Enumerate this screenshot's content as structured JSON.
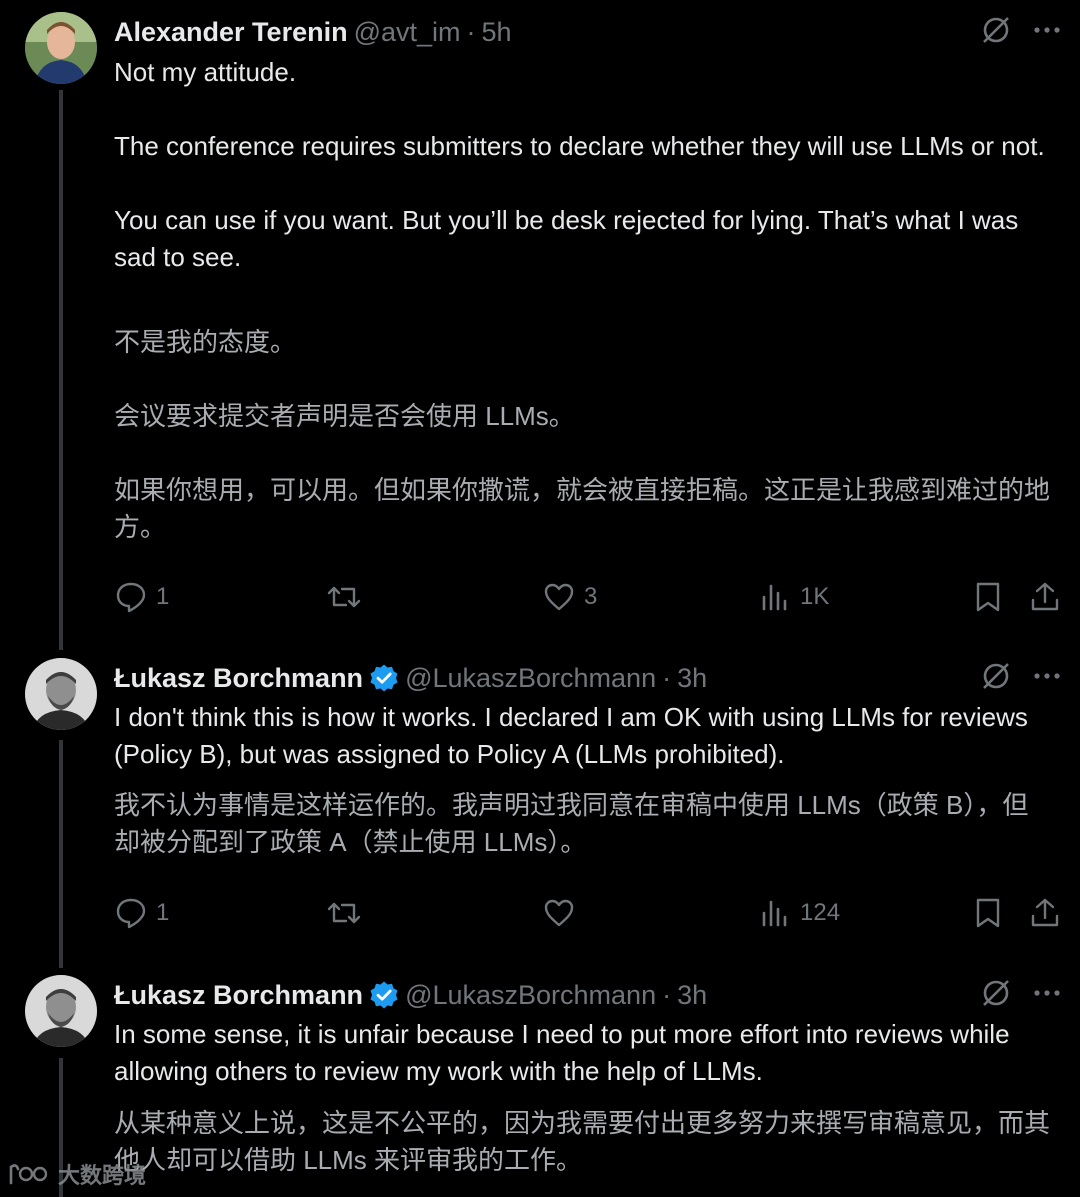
{
  "tweets": [
    {
      "author": "Alexander Terenin",
      "handle": "@avt_im",
      "separator": "·",
      "time": "5h",
      "verified": false,
      "text": [
        "Not my attitude.",
        "",
        "The conference requires submitters to declare whether they will use LLMs or not.",
        "",
        "You can use if you want. But you’ll be desk rejected for lying. That’s what I was sad to see."
      ],
      "translation": [
        "不是我的态度。",
        "",
        "会议要求提交者声明是否会使用 LLMs。",
        "",
        "如果你想用，可以用。但如果你撒谎，就会被直接拒稿。这正是让我感到难过的地方。"
      ],
      "actions": {
        "replies": "1",
        "reposts": "",
        "likes": "3",
        "views": "1K"
      }
    },
    {
      "author": "Łukasz Borchmann",
      "handle": "@LukaszBorchmann",
      "separator": "·",
      "time": "3h",
      "verified": true,
      "text": [
        "I don't think this is how it works. I declared I am OK with using LLMs for reviews (Policy B), but was assigned to Policy A (LLMs prohibited)."
      ],
      "translation": [
        "我不认为事情是这样运作的。我声明过我同意在审稿中使用 LLMs（政策 B），但却被分配到了政策 A（禁止使用 LLMs）。"
      ],
      "actions": {
        "replies": "1",
        "reposts": "",
        "likes": "",
        "views": "124"
      }
    },
    {
      "author": "Łukasz Borchmann",
      "handle": "@LukaszBorchmann",
      "separator": "·",
      "time": "3h",
      "verified": true,
      "text": [
        "In some sense, it is unfair because I need to put more effort into reviews while allowing others to review my work with the help of LLMs."
      ],
      "translation": [
        "从某种意义上说，这是不公平的，因为我需要付出更多努力来撰写审稿意见，而其他人却可以借助 LLMs 来评审我的工作。"
      ],
      "actions": {
        "replies": "",
        "reposts": "",
        "likes": "",
        "views": ""
      }
    }
  ],
  "watermark": "大数跨境",
  "colors": {
    "background": "#000000",
    "text": "#e7e9ea",
    "secondary": "#71767b",
    "translation": "#a9adb1",
    "thread_line": "#333639",
    "verified": "#1d9bf0"
  },
  "icons": {
    "grok": "grok-icon",
    "more": "more-icon",
    "reply": "reply-icon",
    "repost": "repost-icon",
    "like": "like-icon",
    "views": "views-icon",
    "bookmark": "bookmark-icon",
    "share": "share-icon",
    "verified": "verified-badge-icon"
  }
}
